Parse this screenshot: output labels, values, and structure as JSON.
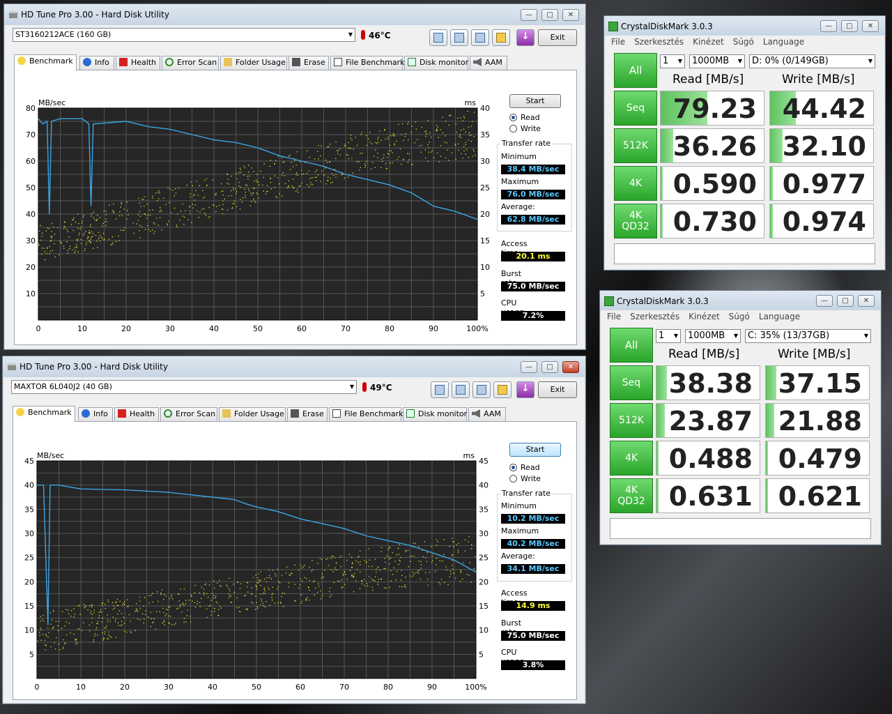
{
  "hdtune": [
    {
      "title": "HD Tune Pro 3.00 - Hard Disk Utility",
      "drive": "ST3160212ACE (160 GB)",
      "temperature": "46°C",
      "exit": "Exit",
      "tabs": [
        "Benchmark",
        "Info",
        "Health",
        "Error Scan",
        "Folder Usage",
        "Erase",
        "File Benchmark",
        "Disk monitor",
        "AAM"
      ],
      "start": "Start",
      "read": "Read",
      "write": "Write",
      "transfer_rate": "Transfer rate",
      "min_label": "Minimum",
      "min": "38.4 MB/sec",
      "max_label": "Maximum",
      "max": "76.0 MB/sec",
      "avg_label": "Average:",
      "avg": "62.8 MB/sec",
      "access_label": "Access time:",
      "access": "20.1 ms",
      "burst_label": "Burst rate",
      "burst": "75.0 MB/sec",
      "cpu_label": "CPU usage",
      "cpu": "7.2%",
      "chart_data": {
        "type": "line",
        "ylabel_left": "MB/sec",
        "ylabel_right": "ms",
        "ylim": [
          0,
          80
        ],
        "ylim_right": [
          0,
          40
        ],
        "yticks": [
          "10",
          "20",
          "30",
          "40",
          "50",
          "60",
          "70",
          "80"
        ],
        "yticks_right": [
          "5",
          "10",
          "15",
          "20",
          "25",
          "30",
          "35",
          "40"
        ],
        "xticks": [
          "0",
          "10",
          "20",
          "30",
          "40",
          "50",
          "60",
          "70",
          "80",
          "90",
          "100%"
        ],
        "series": [
          {
            "values": [
              [
                0,
                76
              ],
              [
                1,
                74
              ],
              [
                2,
                75
              ],
              [
                2.5,
                40
              ],
              [
                3,
                75
              ],
              [
                5,
                76
              ],
              [
                10,
                76
              ],
              [
                11.5,
                74
              ],
              [
                12,
                43
              ],
              [
                12.5,
                74
              ],
              [
                20,
                75
              ],
              [
                25,
                73
              ],
              [
                30,
                72
              ],
              [
                35,
                70
              ],
              [
                40,
                68
              ],
              [
                45,
                67
              ],
              [
                50,
                65
              ],
              [
                55,
                62
              ],
              [
                60,
                60
              ],
              [
                65,
                58
              ],
              [
                70,
                55
              ],
              [
                75,
                53
              ],
              [
                80,
                51
              ],
              [
                85,
                48
              ],
              [
                90,
                43
              ],
              [
                95,
                41
              ],
              [
                100,
                38
              ]
            ]
          }
        ],
        "access_scatter": {
          "ranges": [
            [
              0,
              11,
              18
            ],
            [
              25,
              16,
              24
            ],
            [
              50,
              22,
              30
            ],
            [
              75,
              28,
              36
            ],
            [
              100,
              31,
              40
            ]
          ]
        }
      }
    },
    {
      "title": "HD Tune Pro 3.00 - Hard Disk Utility",
      "drive": "MAXTOR 6L040J2 (40 GB)",
      "temperature": "49°C",
      "exit": "Exit",
      "tabs": [
        "Benchmark",
        "Info",
        "Health",
        "Error Scan",
        "Folder Usage",
        "Erase",
        "File Benchmark",
        "Disk monitor",
        "AAM"
      ],
      "start": "Start",
      "read": "Read",
      "write": "Write",
      "transfer_rate": "Transfer rate",
      "min_label": "Minimum",
      "min": "10.2 MB/sec",
      "max_label": "Maximum",
      "max": "40.2 MB/sec",
      "avg_label": "Average:",
      "avg": "34.1 MB/sec",
      "access_label": "Access time:",
      "access": "14.9 ms",
      "burst_label": "Burst rate",
      "burst": "75.0 MB/sec",
      "cpu_label": "CPU usage",
      "cpu": "3.8%",
      "chart_data": {
        "type": "line",
        "ylabel_left": "MB/sec",
        "ylabel_right": "ms",
        "ylim": [
          0,
          45
        ],
        "ylim_right": [
          0,
          45
        ],
        "yticks": [
          "5",
          "10",
          "15",
          "20",
          "25",
          "30",
          "35",
          "40",
          "45"
        ],
        "yticks_right": [
          "5",
          "10",
          "15",
          "20",
          "25",
          "30",
          "35",
          "40",
          "45"
        ],
        "xticks": [
          "0",
          "10",
          "20",
          "30",
          "40",
          "50",
          "60",
          "70",
          "80",
          "90",
          "100%"
        ],
        "series": [
          {
            "values": [
              [
                0,
                40
              ],
              [
                1.5,
                40
              ],
              [
                2.5,
                11
              ],
              [
                3,
                40
              ],
              [
                5,
                40
              ],
              [
                8,
                39.5
              ],
              [
                10,
                39.2
              ],
              [
                20,
                39
              ],
              [
                30,
                38.5
              ],
              [
                40,
                37.5
              ],
              [
                45,
                37
              ],
              [
                48,
                36
              ],
              [
                50,
                35.5
              ],
              [
                55,
                34.5
              ],
              [
                60,
                33
              ],
              [
                65,
                32
              ],
              [
                70,
                31
              ],
              [
                75,
                29.5
              ],
              [
                80,
                28.5
              ],
              [
                85,
                27.5
              ],
              [
                90,
                26
              ],
              [
                95,
                24.5
              ],
              [
                100,
                22
              ]
            ]
          }
        ],
        "access_scatter": {
          "ranges": [
            [
              0,
              5,
              14
            ],
            [
              25,
              10,
              18
            ],
            [
              50,
              14,
              22
            ],
            [
              75,
              18,
              27
            ],
            [
              100,
              20,
              30
            ]
          ]
        }
      }
    }
  ],
  "cdm": [
    {
      "title": "CrystalDiskMark 3.0.3",
      "menu": [
        "File",
        "Szerkesztés",
        "Kinézet",
        "Súgó",
        "Language"
      ],
      "runs": "1",
      "size": "1000MB",
      "drive": "D: 0% (0/149GB)",
      "all": "All",
      "read_hdr": "Read [MB/s]",
      "write_hdr": "Write [MB/s]",
      "rows": [
        {
          "label": "Seq",
          "read": "79.23",
          "write": "44.42",
          "read_fill": 0.45,
          "write_fill": 0.25
        },
        {
          "label": "512K",
          "read": "36.26",
          "write": "32.10",
          "read_fill": 0.12,
          "write_fill": 0.12
        },
        {
          "label": "4K",
          "read": "0.590",
          "write": "0.977",
          "read_fill": 0.02,
          "write_fill": 0.03
        },
        {
          "label": "4K\nQD32",
          "read": "0.730",
          "write": "0.974",
          "read_fill": 0.02,
          "write_fill": 0.03
        }
      ]
    },
    {
      "title": "CrystalDiskMark 3.0.3",
      "menu": [
        "File",
        "Szerkesztés",
        "Kinézet",
        "Súgó",
        "Language"
      ],
      "runs": "1",
      "size": "1000MB",
      "drive": "C: 35% (13/37GB)",
      "all": "All",
      "read_hdr": "Read [MB/s]",
      "write_hdr": "Write [MB/s]",
      "rows": [
        {
          "label": "Seq",
          "read": "38.38",
          "write": "37.15",
          "read_fill": 0.1,
          "write_fill": 0.1
        },
        {
          "label": "512K",
          "read": "23.87",
          "write": "21.88",
          "read_fill": 0.08,
          "write_fill": 0.08
        },
        {
          "label": "4K",
          "read": "0.488",
          "write": "0.479",
          "read_fill": 0.02,
          "write_fill": 0.02
        },
        {
          "label": "4K\nQD32",
          "read": "0.631",
          "write": "0.621",
          "read_fill": 0.02,
          "write_fill": 0.02
        }
      ]
    }
  ]
}
